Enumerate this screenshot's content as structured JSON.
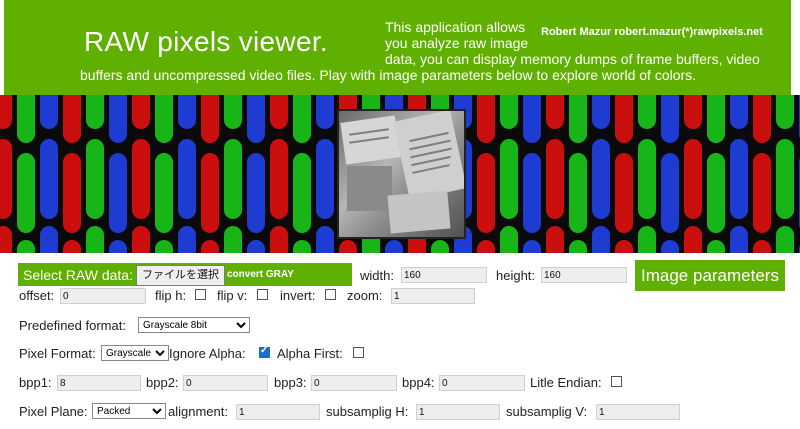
{
  "header": {
    "title": "RAW pixels viewer.",
    "author": "Robert Mazur robert.mazur(*)rawpixels.net",
    "desc_line1": "This application allows",
    "desc_line2": "you analyze raw image",
    "desc_line3": "data, you can display memory dumps of frame buffers, video",
    "desc_line4": "buffers and uncompressed video files. Play with image parameters below to explore world of colors."
  },
  "raw": {
    "label": "Select RAW data:",
    "file_button": "ファイルを選択",
    "convert_label": "convert GRAY"
  },
  "image_params_button": "Image parameters",
  "fields": {
    "width_label": "width:",
    "width_value": "160",
    "height_label": "height:",
    "height_value": "160",
    "offset_label": "offset:",
    "offset_value": "0",
    "flip_h_label": "flip h:",
    "flip_v_label": "flip v:",
    "invert_label": "invert:",
    "zoom_label": "zoom:",
    "zoom_value": "1",
    "predefined_label": "Predefined format:",
    "predefined_value": "Grayscale 8bit",
    "pixel_format_label": "Pixel Format:",
    "pixel_format_value": "Grayscale",
    "ignore_alpha_label": "Ignore Alpha:",
    "alpha_first_label": "Alpha First:",
    "bpp1_label": "bpp1:",
    "bpp1_value": "8",
    "bpp2_label": "bpp2:",
    "bpp2_value": "0",
    "bpp3_label": "bpp3:",
    "bpp3_value": "0",
    "bpp4_label": "bpp4:",
    "bpp4_value": "0",
    "little_endian_label": "Litle Endian:",
    "pixel_plane_label": "Pixel Plane:",
    "pixel_plane_value": "Packed",
    "alignment_label": "alignment:",
    "alignment_value": "1",
    "subsampling_h_label": "subsamplig H:",
    "subsampling_h_value": "1",
    "subsampling_v_label": "subsamplig V:",
    "subsampling_v_value": "1"
  },
  "checkboxes": {
    "flip_h": false,
    "flip_v": false,
    "invert": false,
    "ignore_alpha": true,
    "alpha_first": false,
    "little_endian": false
  },
  "colors": {
    "accent": "#5fb000",
    "subpixel_red": "#e01010",
    "subpixel_green": "#18c818",
    "subpixel_blue": "#2040e8"
  }
}
